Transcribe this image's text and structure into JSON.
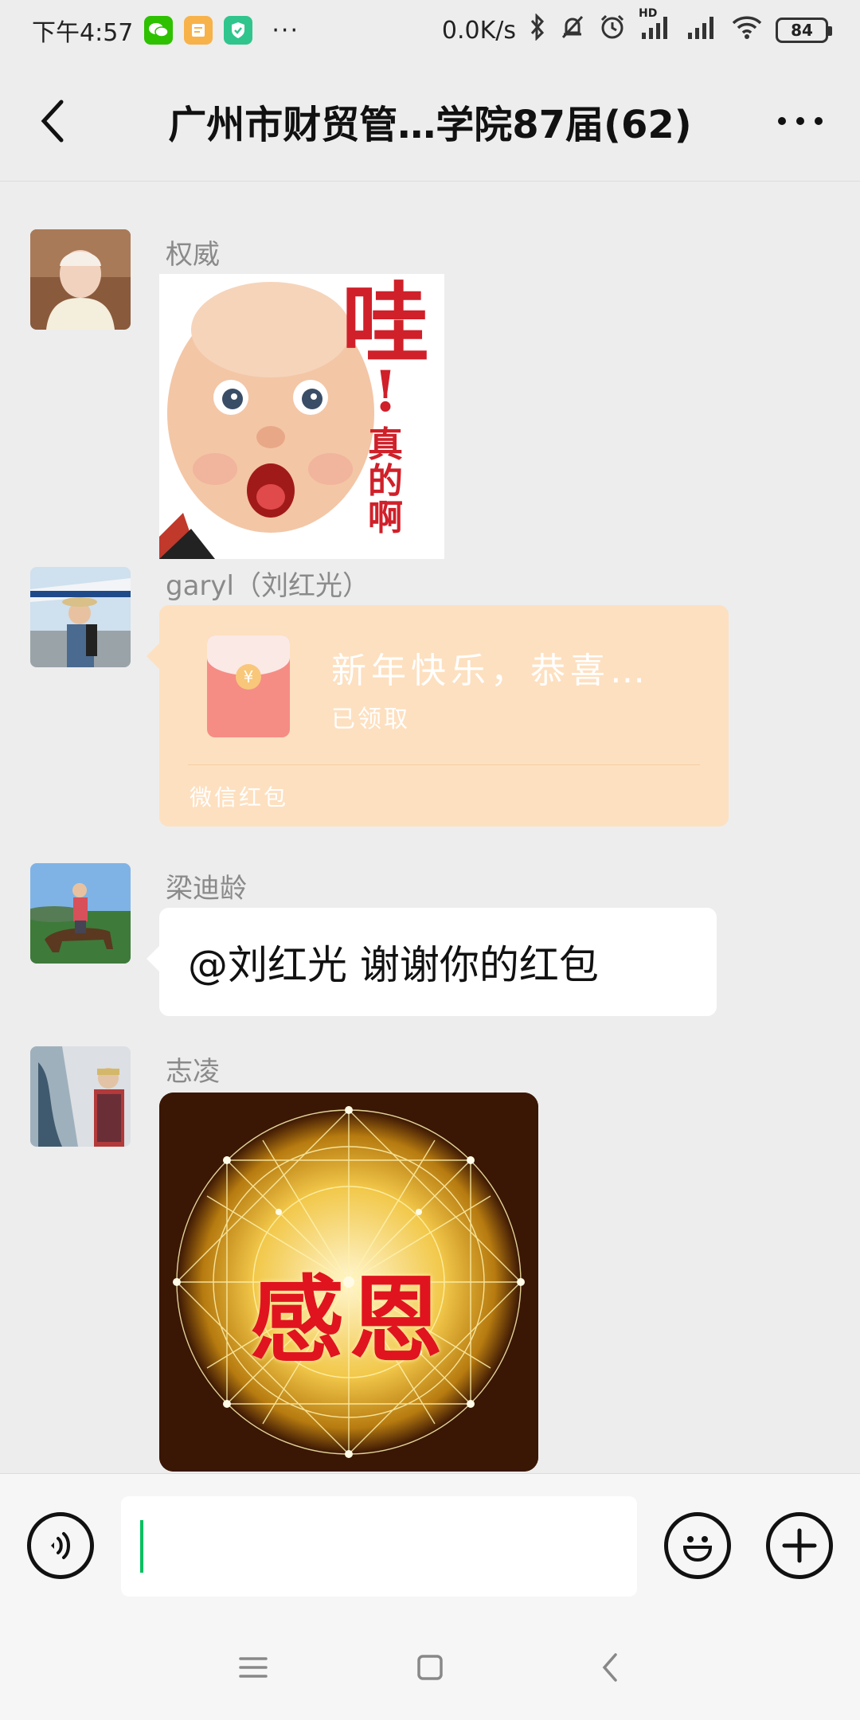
{
  "status_bar": {
    "time": "下午4:57",
    "more": "···",
    "network_speed": "0.0K/s",
    "battery": "84",
    "hd_label": "HD"
  },
  "nav": {
    "title": "广州市财贸管…学院87届(62)",
    "back_icon": "chevron-left-icon",
    "more_icon": "more-dots-icon"
  },
  "messages": [
    {
      "sender": "权威",
      "type": "sticker",
      "sticker_text": [
        "哇",
        "!",
        "真",
        "的",
        "啊"
      ]
    },
    {
      "sender": "garyl（刘红光）",
      "type": "red_packet",
      "title": "新年快乐，恭喜…",
      "status": "已领取",
      "footer": "微信红包",
      "coin_symbol": "¥"
    },
    {
      "sender": "梁迪龄",
      "type": "text",
      "text": "@刘红光  谢谢你的红包"
    },
    {
      "sender": "志凌",
      "type": "sticker",
      "sticker_text": "感恩"
    }
  ],
  "input": {
    "placeholder": "",
    "voice_icon": "voice-icon",
    "emoji_icon": "emoji-icon",
    "plus_icon": "plus-icon"
  },
  "colors": {
    "background": "#ededed",
    "red_packet": "#fde0c0",
    "accent": "#07c160"
  }
}
